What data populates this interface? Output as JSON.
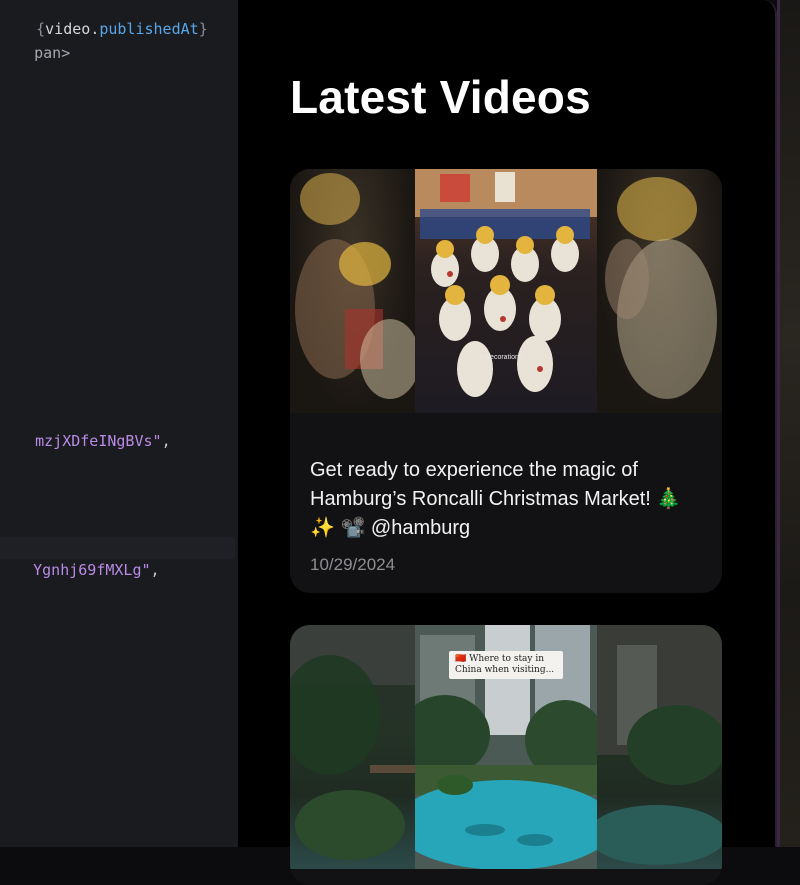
{
  "editor": {
    "lines": [
      {
        "brace": "{",
        "var": "video",
        "dot": ".",
        "prop": "publishedAt",
        "close": "}"
      },
      {
        "tag": "pan>"
      },
      {
        "str": "mzjXDfeINgBVs\"",
        "punc": ","
      },
      {
        "str": "Ygnhj69fMXLg\"",
        "punc": ","
      }
    ]
  },
  "preview": {
    "heading": "Latest Videos",
    "videos": [
      {
        "title": "Get ready to experience the magic of Hamburg’s Roncalli Christmas Market! 🎄✨ 📽️ @hamburg",
        "date": "10/29/2024",
        "thumb_caption": "or decorations."
      },
      {
        "thumb_caption": "🇨🇳 Where to stay in China when visiting..."
      }
    ]
  }
}
